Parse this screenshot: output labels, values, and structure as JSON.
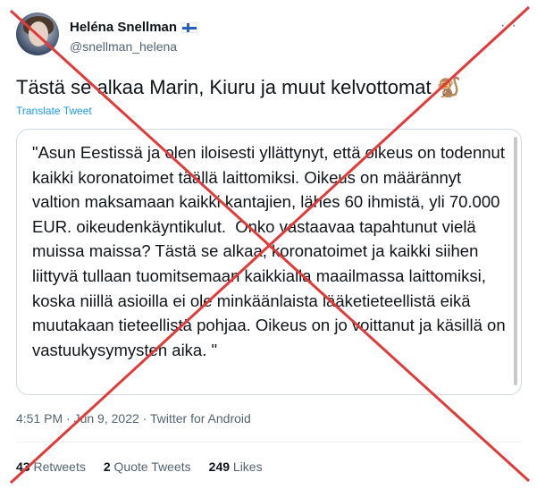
{
  "author": {
    "name": "Heléna Snellman",
    "handle": "@snellman_helena",
    "flag_icon": "finland-flag-icon"
  },
  "menu": {
    "more_label": "···"
  },
  "tweet": {
    "text": "Tästä se alkaa Marin, Kiuru ja muut kelvottomat",
    "emoji": "🐒",
    "translate_label": "Translate Tweet"
  },
  "quote": {
    "text": "\"Asun Eestissä ja olen iloisesti yllättynyt, että oikeus on todennut kaikki koronatoimet täällä laittomiksi. Oikeus on määrännyt valtion maksamaan kaikki kantajien, lähes 60 ihmistä, yli 70.000 EUR. oikeudenkäyntikulut.  Onko vastaavaa tapahtunut vielä muissa maissa? Tästä se alkaa, koronatoimet ja kaikki siihen liittyvä tullaan tuomitsemaan kaikkialla maailmassa laittomiksi, koska niillä asioilla ei ole minkäänlaista lääketieteellistä eikä muutakaan tieteellistä pohjaa. Oikeus on jo voittanut ja käsillä on vastuukysymysten aika. \""
  },
  "meta": {
    "time": "4:51 PM",
    "separator": "·",
    "date": "Jun 9, 2022",
    "source": "Twitter for Android"
  },
  "stats": {
    "retweets_count": "43",
    "retweets_label": "Retweets",
    "quotes_count": "2",
    "quotes_label": "Quote Tweets",
    "likes_count": "249",
    "likes_label": "Likes"
  },
  "overlay": {
    "cross_color": "#e03a3a"
  }
}
